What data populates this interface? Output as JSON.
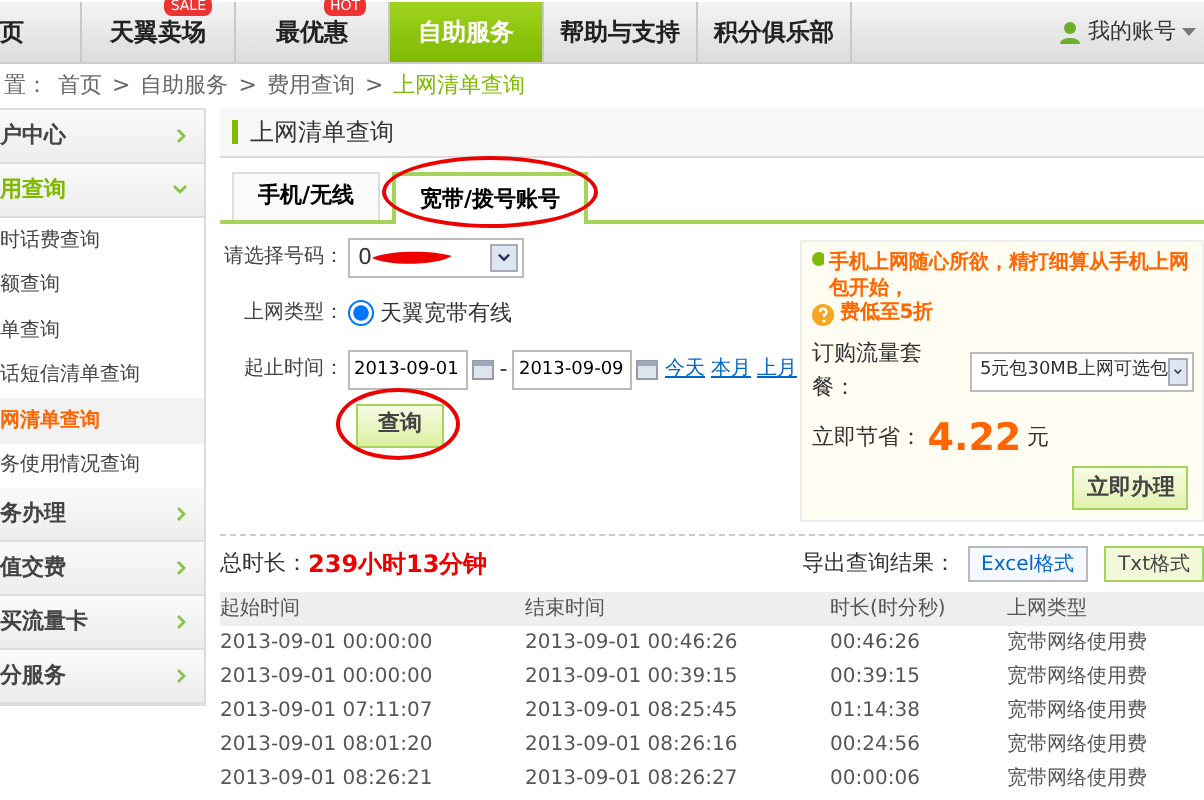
{
  "nav": {
    "items": [
      {
        "label": "页",
        "selected": false
      },
      {
        "label": "天翼卖场",
        "selected": false,
        "badge": "SALE"
      },
      {
        "label": "最优惠",
        "selected": false,
        "badge": "HOT"
      },
      {
        "label": "自助服务",
        "selected": true
      },
      {
        "label": "帮助与支持",
        "selected": false
      },
      {
        "label": "积分俱乐部",
        "selected": false
      }
    ],
    "account": "我的账号"
  },
  "breadcrumb": {
    "prefix": "置：",
    "separator": ">",
    "items": [
      {
        "label": "首页",
        "selected": false
      },
      {
        "label": "自助服务",
        "selected": false
      },
      {
        "label": "费用查询",
        "selected": false
      },
      {
        "label": "上网清单查询",
        "selected": true
      }
    ]
  },
  "sidebar": {
    "items": [
      {
        "label": "户中心",
        "expanded": false
      },
      {
        "label": "用查询",
        "expanded": true,
        "children": [
          {
            "label": "时话费查询",
            "selected": false
          },
          {
            "label": "额查询",
            "selected": false
          },
          {
            "label": "单查询",
            "selected": false
          },
          {
            "label": "话短信清单查询",
            "selected": false
          },
          {
            "label": "网清单查询",
            "selected": true
          },
          {
            "label": "务使用情况查询",
            "selected": false
          }
        ]
      },
      {
        "label": "务办理",
        "expanded": false
      },
      {
        "label": "值交费",
        "expanded": false
      },
      {
        "label": "买流量卡",
        "expanded": false
      },
      {
        "label": "分服务",
        "expanded": false
      }
    ]
  },
  "panel": {
    "title": "上网清单查询",
    "tabs": [
      {
        "label": "手机/无线",
        "selected": false,
        "circled": false
      },
      {
        "label": "宽带/拨号账号",
        "selected": true,
        "circled": true
      }
    ],
    "form": {
      "number": {
        "label": "请选择号码：",
        "value": "0",
        "redacted": true
      },
      "type": {
        "label": "上网类型：",
        "option": "天翼宽带有线",
        "checked": true
      },
      "dates": {
        "label": "起止时间：",
        "start": "2013-09-01",
        "separator": "-",
        "end": "2013-09-09",
        "links": [
          "今天",
          "本月",
          "上月"
        ]
      },
      "query_button": {
        "label": "查询",
        "circled": true
      }
    },
    "promo": {
      "line_1": "手机上网随心所欲，精打细算从手机上网包开始，",
      "line_2": "费低至5折",
      "package_label": "订购流量套餐：",
      "package_value": "5元包30MB上网可选包",
      "saving_label": "立即节省：",
      "saving_amount": "4.22",
      "saving_unit": "元",
      "button": "立即办理"
    },
    "summary": {
      "total_label": "总时长：",
      "total": "239小时13分钟",
      "export_label": "导出查询结果：",
      "export_buttons": [
        {
          "label": "Excel格式",
          "kind": "excel"
        },
        {
          "label": "Txt格式",
          "kind": "txt"
        }
      ]
    },
    "table": {
      "columns": [
        "起始时间",
        "结束时间",
        "时长(时分秒)",
        "上网类型"
      ],
      "rows": [
        [
          "2013-09-01 00:00:00",
          "2013-09-01 00:46:26",
          "00:46:26",
          "宽带网络使用费"
        ],
        [
          "2013-09-01 00:00:00",
          "2013-09-01 00:39:15",
          "00:39:15",
          "宽带网络使用费"
        ],
        [
          "2013-09-01 07:11:07",
          "2013-09-01 08:25:45",
          "01:14:38",
          "宽带网络使用费"
        ],
        [
          "2013-09-01 08:01:20",
          "2013-09-01 08:26:16",
          "00:24:56",
          "宽带网络使用费"
        ],
        [
          "2013-09-01 08:26:21",
          "2013-09-01 08:26:27",
          "00:00:06",
          "宽带网络使用费"
        ]
      ]
    }
  }
}
